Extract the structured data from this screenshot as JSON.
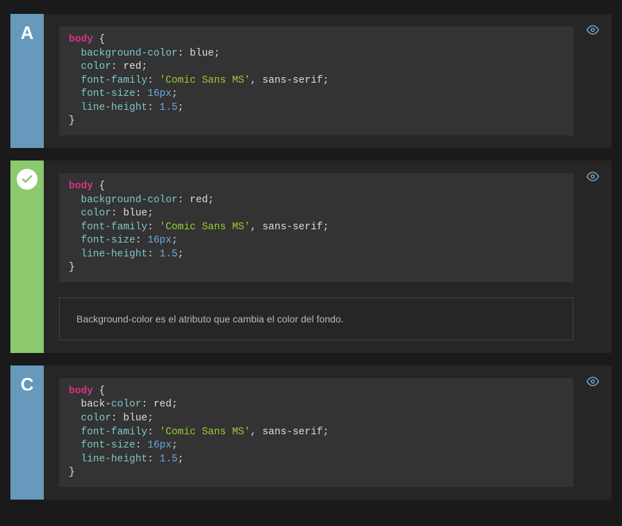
{
  "options": [
    {
      "id": "a",
      "badge": {
        "type": "letter",
        "value": "A",
        "color": "blue"
      },
      "code": {
        "selector": "body",
        "rules": [
          {
            "prop": "background-color",
            "valueType": "val",
            "value": "blue"
          },
          {
            "prop": "color",
            "valueType": "val",
            "value": "red"
          },
          {
            "prop": "font-family",
            "valueType": "str",
            "value": "'Comic Sans MS'",
            "suffix": ", sans-serif"
          },
          {
            "prop": "font-size",
            "valueType": "num",
            "value": "16px"
          },
          {
            "prop": "line-height",
            "valueType": "num",
            "value": "1.5"
          }
        ]
      },
      "explanation": null
    },
    {
      "id": "b",
      "badge": {
        "type": "check",
        "value": "",
        "color": "green"
      },
      "code": {
        "selector": "body",
        "rules": [
          {
            "prop": "background-color",
            "valueType": "val",
            "value": "red"
          },
          {
            "prop": "color",
            "valueType": "val",
            "value": "blue"
          },
          {
            "prop": "font-family",
            "valueType": "str",
            "value": "'Comic Sans MS'",
            "suffix": ", sans-serif"
          },
          {
            "prop": "font-size",
            "valueType": "num",
            "value": "16px"
          },
          {
            "prop": "line-height",
            "valueType": "num",
            "value": "1.5"
          }
        ]
      },
      "explanation": "Background-color es el atributo que cambia el color del fondo."
    },
    {
      "id": "c",
      "badge": {
        "type": "letter",
        "value": "C",
        "color": "blue"
      },
      "code": {
        "selector": "body",
        "rules": [
          {
            "propTokens": [
              {
                "t": "back-",
                "cls": "tk-val"
              },
              {
                "t": "color",
                "cls": "tk-prop"
              }
            ],
            "valueType": "val",
            "value": "red"
          },
          {
            "prop": "color",
            "valueType": "val",
            "value": "blue"
          },
          {
            "prop": "font-family",
            "valueType": "str",
            "value": "'Comic Sans MS'",
            "suffix": ", sans-serif"
          },
          {
            "prop": "font-size",
            "valueType": "num",
            "value": "16px"
          },
          {
            "prop": "line-height",
            "valueType": "num",
            "value": "1.5"
          }
        ]
      },
      "explanation": null
    }
  ]
}
